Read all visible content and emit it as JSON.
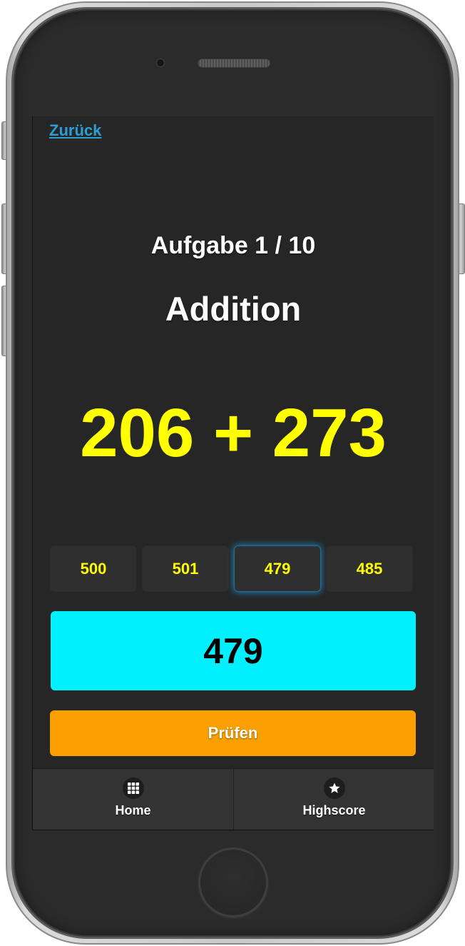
{
  "screen": {
    "back_link": "Zurück",
    "counter": "Aufgabe 1 / 10",
    "operation": "Addition",
    "problem": {
      "operand1": "206",
      "operator": "+",
      "operand2": "273"
    },
    "options": [
      {
        "label": "500",
        "selected": false
      },
      {
        "label": "501",
        "selected": false
      },
      {
        "label": "479",
        "selected": true
      },
      {
        "label": "485",
        "selected": false
      }
    ],
    "answer": "479",
    "check_button": "Prüfen"
  },
  "nav": {
    "items": [
      {
        "label": "Home",
        "icon": "grid-icon"
      },
      {
        "label": "Highscore",
        "icon": "star-icon"
      }
    ]
  },
  "colors": {
    "background": "#262626",
    "problem_text": "#ffff00",
    "option_text": "#ffff00",
    "answer_box": "#00f0ff",
    "check_button": "#f9a000",
    "link": "#2a9fd6",
    "selected_glow": "#1e90d0"
  }
}
